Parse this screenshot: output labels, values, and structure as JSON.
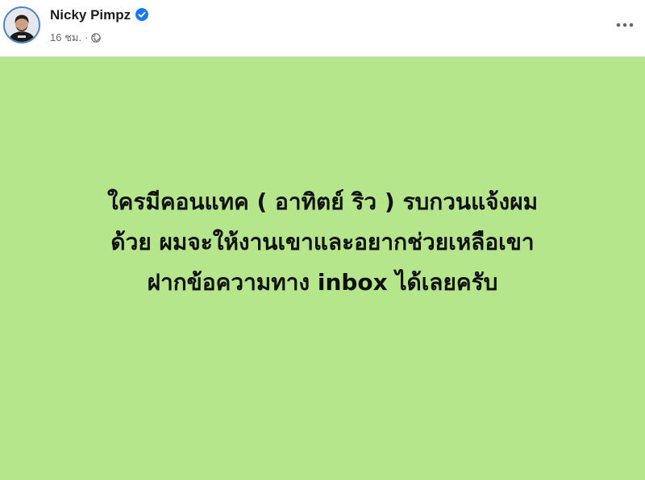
{
  "post": {
    "author": "Nicky Pimpz",
    "timestamp": "16 ชม.",
    "separator": "·",
    "audience_icon": "globe-icon",
    "verified_icon": "verified-badge-icon",
    "more_icon": "more-options-icon",
    "background_color": "#b6e68c",
    "text_lines": [
      "ใครมีคอนแทค ( อาทิตย์ ริว ) รบกวนแจ้งผม",
      "ด้วย ผมจะให้งานเขาและอยากช่วยเหลือเขา",
      "ฝากข้อความทาง inbox ได้เลยครับ"
    ]
  }
}
